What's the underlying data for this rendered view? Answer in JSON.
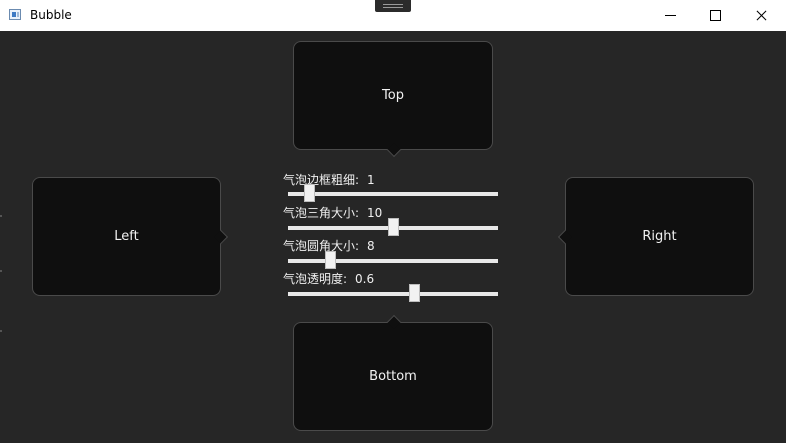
{
  "window": {
    "title": "Bubble"
  },
  "bubbles": {
    "top": "Top",
    "left": "Left",
    "right": "Right",
    "bottom": "Bottom"
  },
  "controls": [
    {
      "label": "气泡边框粗细:",
      "value": "1",
      "fraction": 0.1
    },
    {
      "label": "气泡三角大小:",
      "value": "10",
      "fraction": 0.5
    },
    {
      "label": "气泡圆角大小:",
      "value": "8",
      "fraction": 0.2
    },
    {
      "label": "气泡透明度:",
      "value": "0.6",
      "fraction": 0.6
    }
  ],
  "colors": {
    "background": "#262626",
    "bubble_fill": "#0f0f0f",
    "bubble_border": "#4a4a4a",
    "text": "#f2f2f2"
  }
}
